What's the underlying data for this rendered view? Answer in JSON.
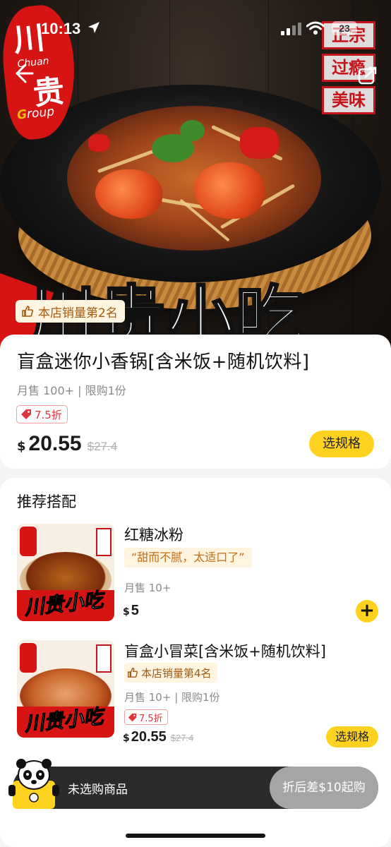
{
  "status_bar": {
    "time": "10:13",
    "battery": "23"
  },
  "hero": {
    "brand_chuan": "川",
    "brand_gui": "贵",
    "brand_en": "Chuan",
    "brand_group": "Group",
    "seal": [
      "正宗",
      "过瘾",
      "美味"
    ],
    "big_title": "川贵小吃",
    "rank_badge": "本店销量第2名"
  },
  "product": {
    "name": "盲盒迷你小香锅[含米饭+随机饮料]",
    "meta": "月售 100+ | 限购1份",
    "discount": "7.5折",
    "currency": "$",
    "price": "20.55",
    "original_price": "$27.4",
    "spec_button": "选规格"
  },
  "recommend": {
    "title": "推荐搭配",
    "items": [
      {
        "name": "红糖冰粉",
        "quote": "“甜而不腻，太适口了”",
        "meta": "月售 10+",
        "currency": "$",
        "price": "5",
        "thumb_word": "川贵小吃"
      },
      {
        "name": "盲盒小冒菜[含米饭+随机饮料]",
        "rank": "本店销量第4名",
        "meta": "月售 10+ | 限购1份",
        "discount": "7.5折",
        "currency": "$",
        "price": "20.55",
        "original_price": "$27.4",
        "spec_button": "选规格",
        "thumb_word": "川贵小吃"
      }
    ]
  },
  "cart": {
    "empty_text": "未选购商品",
    "checkout_label": "折后差$10起购"
  },
  "colors": {
    "accent": "#ffd21f",
    "brand_red": "#d71414",
    "discount_red": "#e0333a"
  }
}
